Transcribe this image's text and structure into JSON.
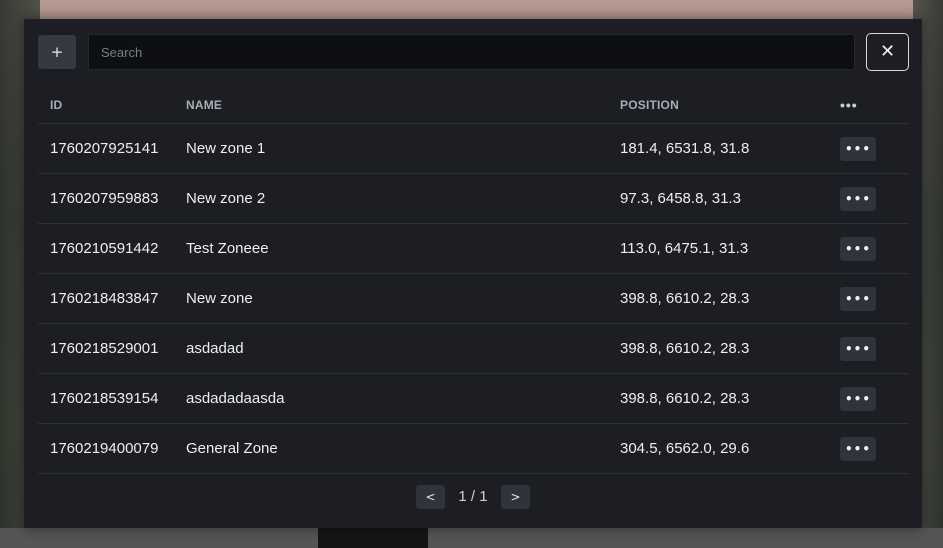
{
  "toolbar": {
    "add_label": "+",
    "close_label": "✕"
  },
  "search": {
    "placeholder": "Search",
    "value": ""
  },
  "table": {
    "headers": {
      "id": "ID",
      "name": "NAME",
      "position": "POSITION",
      "actions": "•••"
    },
    "action_label": "•••",
    "rows": [
      {
        "id": "1760207925141",
        "name": "New zone 1",
        "position": "181.4, 6531.8, 31.8"
      },
      {
        "id": "1760207959883",
        "name": "New zone 2",
        "position": "97.3, 6458.8, 31.3"
      },
      {
        "id": "1760210591442",
        "name": "Test Zoneee",
        "position": "113.0, 6475.1, 31.3"
      },
      {
        "id": "1760218483847",
        "name": "New zone",
        "position": "398.8, 6610.2, 28.3"
      },
      {
        "id": "1760218529001",
        "name": "asdadad",
        "position": "398.8, 6610.2, 28.3"
      },
      {
        "id": "1760218539154",
        "name": "asdadadaasda",
        "position": "398.8, 6610.2, 28.3"
      },
      {
        "id": "1760219400079",
        "name": "General Zone",
        "position": "304.5, 6562.0, 29.6"
      }
    ]
  },
  "pagination": {
    "prev_label": "<",
    "next_label": ">",
    "page_text": "1 / 1"
  },
  "colors": {
    "panel": "#1c1e24",
    "row_divider": "#2d3038",
    "button": "#30333b",
    "text": "#eceef1",
    "header_text": "#a9acb2"
  }
}
